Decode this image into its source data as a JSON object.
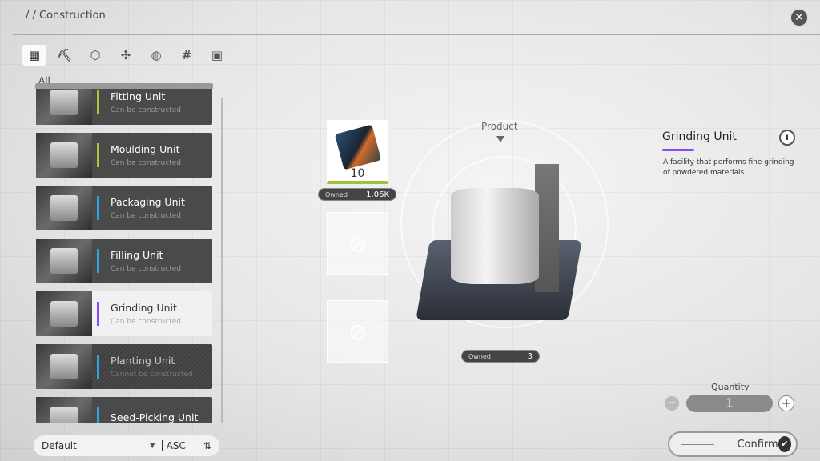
{
  "header": {
    "breadcrumb": "/ / Construction",
    "close_icon": "close-icon"
  },
  "category_tabs": [
    {
      "icon": "grid-icon",
      "glyph": "▦",
      "active": true
    },
    {
      "icon": "pickaxe-icon",
      "glyph": "⛏"
    },
    {
      "icon": "hexagon-icon",
      "glyph": "⬡"
    },
    {
      "icon": "fan-icon",
      "glyph": "✣"
    },
    {
      "icon": "power-icon",
      "glyph": "◍"
    },
    {
      "icon": "hash-icon",
      "glyph": "#"
    },
    {
      "icon": "robot-icon",
      "glyph": "▣"
    }
  ],
  "list": {
    "section": "All",
    "items": [
      {
        "name": "Fitting Unit",
        "status": "Can be constructed",
        "accent": "#a5c93a"
      },
      {
        "name": "Moulding Unit",
        "status": "Can be constructed",
        "accent": "#a5c93a"
      },
      {
        "name": "Packaging Unit",
        "status": "Can be constructed",
        "accent": "#2fa3e0"
      },
      {
        "name": "Filling Unit",
        "status": "Can be constructed",
        "accent": "#2fa3e0"
      },
      {
        "name": "Grinding Unit",
        "status": "Can be constructed",
        "accent": "#8a4af0",
        "selected": true
      },
      {
        "name": "Planting Unit",
        "status": "Cannot be constructed",
        "accent": "#2fa3e0",
        "disabled": true
      },
      {
        "name": "Seed-Picking Unit",
        "status": "",
        "accent": "#2fa3e0"
      }
    ]
  },
  "sort": {
    "value": "Default",
    "order": "ASC"
  },
  "recipe": {
    "product_label": "Product",
    "ingredient": {
      "count": "10",
      "owned_label": "Owned",
      "owned": "1.06K"
    },
    "product_owned_label": "Owned",
    "product_owned": "3"
  },
  "detail": {
    "title": "Grinding Unit",
    "description": "A facility that performs fine grinding of powdered materials.",
    "accent": "#8a4af0"
  },
  "quantity": {
    "label": "Quantity",
    "value": "1"
  },
  "confirm": {
    "label": "Confirm"
  }
}
